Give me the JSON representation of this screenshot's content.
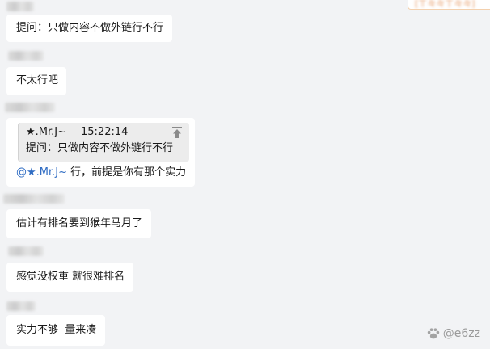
{
  "corner_card": {
    "text": "[ㄒ々々ㄒ々々]"
  },
  "messages": [
    {
      "text": "提问：只做内容不做外链行不行"
    },
    {
      "text": "不太行吧"
    },
    {
      "quote": {
        "author": "★.Mr.J~",
        "time": "15:22:14",
        "text": "提问：只做内容不做外链行不行",
        "jump_icon": "jump-to-top-icon"
      },
      "mention": "@★.Mr.J~",
      "reply": " 行，前提是你有那个实力"
    },
    {
      "text": "估计有排名要到猴年马月了"
    },
    {
      "text": "感觉没权重 就很难排名"
    },
    {
      "text": "实力不够  量来凑"
    }
  ],
  "watermark": {
    "icon": "paw-icon",
    "text": "@e6zz"
  },
  "colors": {
    "background": "#f2f3f5",
    "bubble": "#ffffff",
    "quote_background": "#ececec",
    "mention": "#2f6cc3",
    "corner_border": "#f3d0ad",
    "corner_text": "#e5935a"
  }
}
